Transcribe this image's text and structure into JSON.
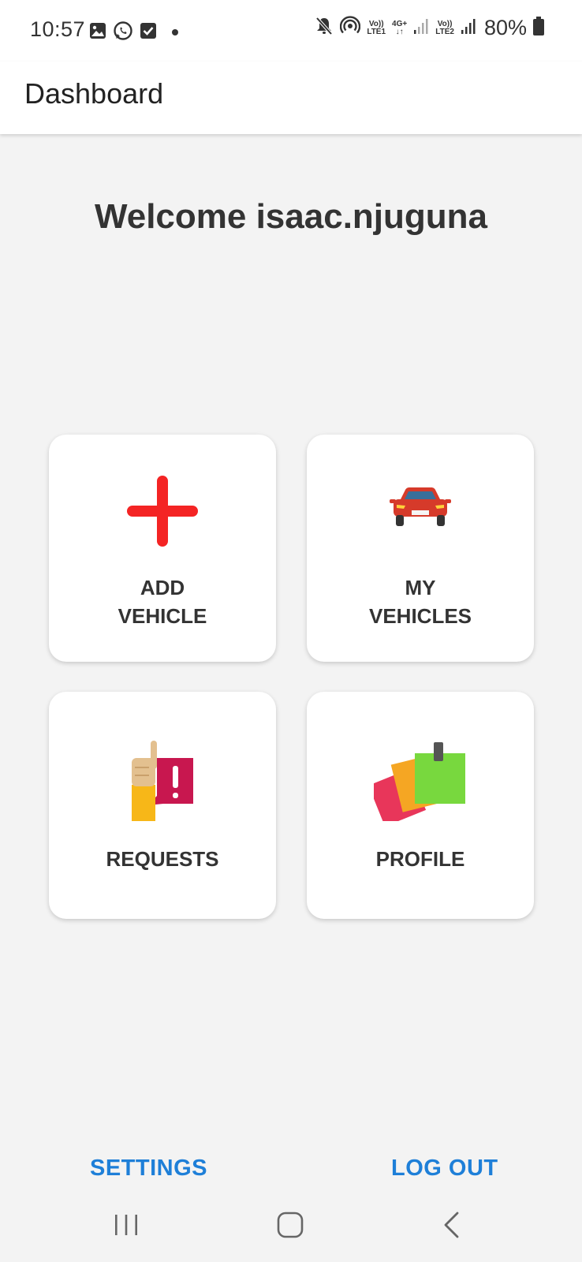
{
  "status_bar": {
    "time": "10:57",
    "left_icons": [
      "gallery-icon",
      "whatsapp-icon",
      "checkbox-icon",
      "dot-icon"
    ],
    "right_icons": [
      "mute-icon",
      "hotspot-icon",
      "volte-lte1-icon",
      "4g-plus-icon",
      "signal-icon",
      "volte-lte2-icon",
      "signal-icon",
      "battery-icon"
    ],
    "sim1_top": "Vo))",
    "sim1_bottom": "LTE1",
    "net_type": "4G+",
    "sim2_top": "Vo))",
    "sim2_bottom": "LTE2",
    "battery": "80%"
  },
  "app_bar": {
    "title": "Dashboard"
  },
  "welcome": "Welcome isaac.njuguna",
  "cards": [
    {
      "icon": "plus-icon",
      "label_line1": "ADD",
      "label_line2": "VEHICLE"
    },
    {
      "icon": "car-icon",
      "label_line1": "MY",
      "label_line2": "VEHICLES"
    },
    {
      "icon": "request-icon",
      "label_line1": "REQUESTS",
      "label_line2": ""
    },
    {
      "icon": "profile-notes-icon",
      "label_line1": "PROFILE",
      "label_line2": ""
    }
  ],
  "footer": {
    "settings_label": "SETTINGS",
    "logout_label": "LOG OUT"
  },
  "colors": {
    "accent": "#1e7fd8",
    "background": "#f3f3f3",
    "plus_red": "#f42424",
    "car_red": "#d63a2a"
  }
}
